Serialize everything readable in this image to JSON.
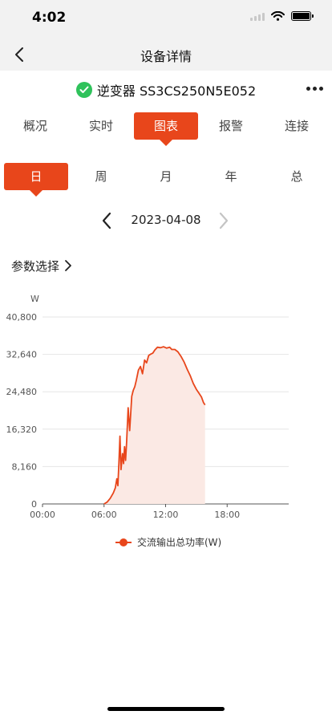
{
  "status_bar": {
    "time": "4:02"
  },
  "nav": {
    "title": "设备详情"
  },
  "device": {
    "name": "逆变器 SS3CS250N5E052",
    "status_color": "#2fc25b"
  },
  "tabs": [
    {
      "label": "概况",
      "active": false
    },
    {
      "label": "实时",
      "active": false
    },
    {
      "label": "图表",
      "active": true
    },
    {
      "label": "报警",
      "active": false
    },
    {
      "label": "连接",
      "active": false
    }
  ],
  "period_tabs": [
    {
      "label": "日",
      "active": true
    },
    {
      "label": "周",
      "active": false
    },
    {
      "label": "月",
      "active": false
    },
    {
      "label": "年",
      "active": false
    },
    {
      "label": "总",
      "active": false
    }
  ],
  "date_nav": {
    "date": "2023-04-08"
  },
  "param_select": {
    "label": "参数选择"
  },
  "colors": {
    "accent": "#e8461b",
    "fill": "#fbe9e4",
    "grid": "#e6e6e6"
  },
  "chart_data": {
    "type": "area",
    "ylabel": "W",
    "xlabel": "",
    "ylim": [
      0,
      40800
    ],
    "yticks": [
      0,
      8160,
      16320,
      24480,
      32640,
      40800
    ],
    "ytick_labels": [
      "0",
      "8,160",
      "16,320",
      "24,480",
      "32,640",
      "40,800"
    ],
    "xlim": [
      0,
      24
    ],
    "xticks": [
      0,
      6,
      12,
      18
    ],
    "xtick_labels": [
      "00:00",
      "06:00",
      "12:00",
      "18:00"
    ],
    "grid": true,
    "legend_position": "bottom-center",
    "series": [
      {
        "name": "交流输出总功率(W)",
        "color": "#e8461b",
        "x": [
          6.0,
          6.3,
          6.6,
          6.9,
          7.1,
          7.25,
          7.35,
          7.45,
          7.55,
          7.65,
          7.8,
          7.9,
          8.0,
          8.1,
          8.2,
          8.35,
          8.5,
          8.7,
          8.85,
          9.0,
          9.15,
          9.35,
          9.55,
          9.75,
          9.95,
          10.15,
          10.35,
          10.55,
          10.75,
          10.95,
          11.2,
          11.5,
          11.8,
          12.1,
          12.4,
          12.6,
          12.9,
          13.2,
          13.5,
          13.8,
          14.1,
          14.4,
          14.7,
          15.0,
          15.3,
          15.5,
          15.7,
          15.85
        ],
        "y": [
          0,
          400,
          1200,
          2400,
          3500,
          5500,
          4000,
          9000,
          14800,
          7500,
          11000,
          8800,
          12500,
          9500,
          13500,
          21000,
          16000,
          23500,
          24800,
          25600,
          27000,
          29200,
          30000,
          28400,
          31400,
          30800,
          32400,
          32700,
          32900,
          33600,
          34200,
          34100,
          34300,
          34000,
          34200,
          33700,
          33700,
          33200,
          32200,
          31000,
          29400,
          28000,
          26300,
          25000,
          24000,
          23300,
          22100,
          21600
        ]
      }
    ]
  }
}
